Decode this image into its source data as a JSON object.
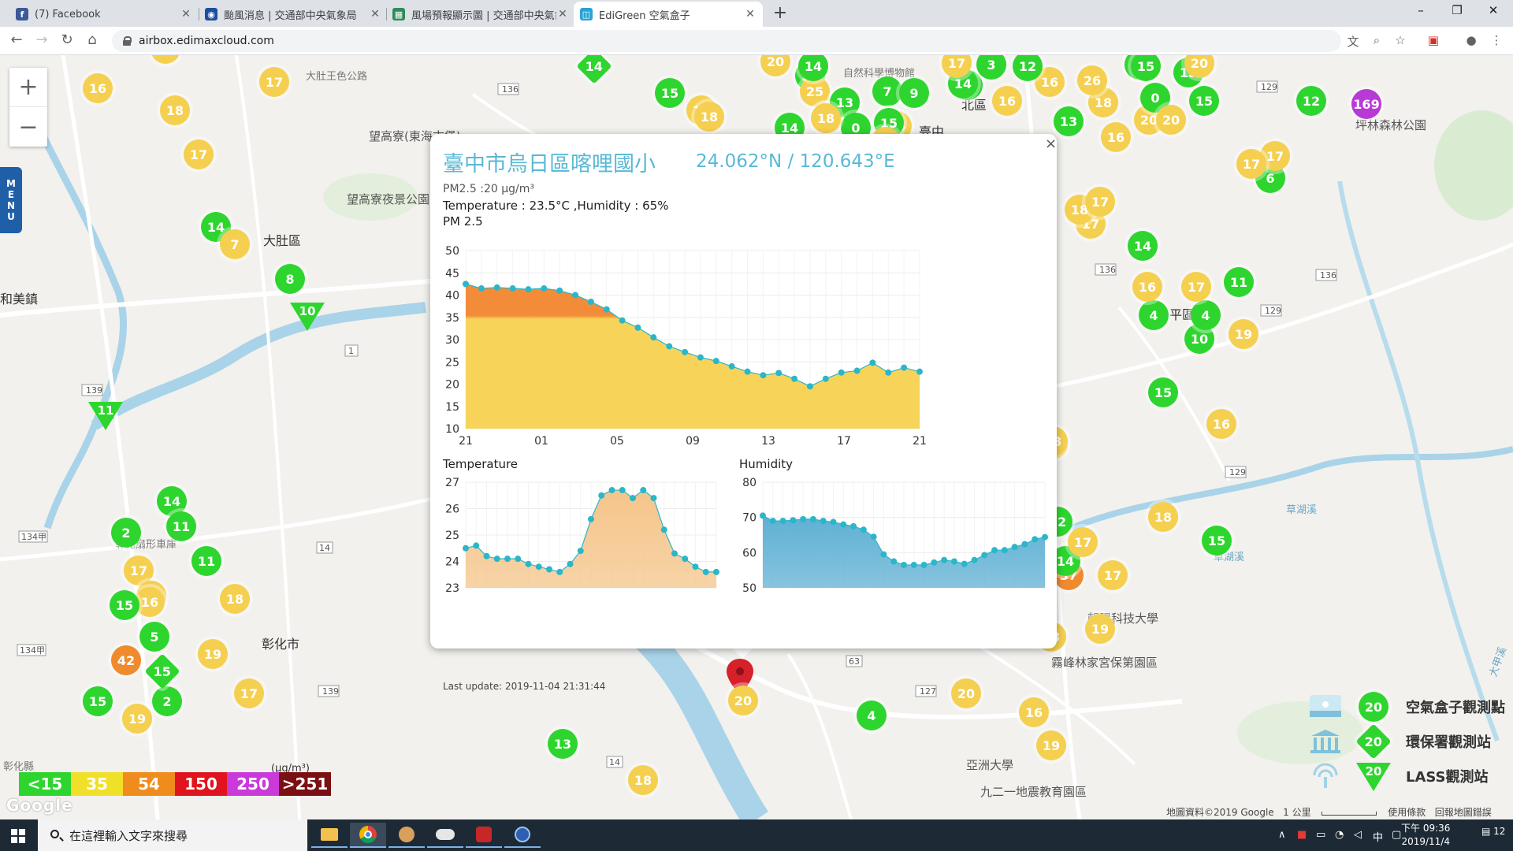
{
  "browser": {
    "tabs": [
      {
        "title": "(7) Facebook",
        "icon": "facebook-icon",
        "color": "#3b5998",
        "glyph": "f"
      },
      {
        "title": "颱風消息 | 交通部中央氣象局",
        "icon": "cwb-icon",
        "color": "#1a4fa0",
        "glyph": "◉"
      },
      {
        "title": "風場預報顯示圖 | 交通部中央氣象局",
        "icon": "cwb-wind-icon",
        "color": "#2e8b57",
        "glyph": "▦"
      },
      {
        "title": "EdiGreen 空氣盒子",
        "icon": "edigreen-icon",
        "color": "#29a3d4",
        "glyph": "◫"
      }
    ],
    "active_tab": 3,
    "url": "airbox.edimaxcloud.com",
    "new_tab": "+",
    "window_controls": {
      "minimize": "–",
      "maximize": "❐",
      "close": "✕"
    }
  },
  "map": {
    "zoom_in": "+",
    "zoom_out": "−",
    "menu": [
      "M",
      "E",
      "N",
      "U"
    ],
    "places": [
      {
        "text": "大肚區",
        "cls": "big"
      },
      {
        "text": "彰化市",
        "cls": "big"
      },
      {
        "text": "和美鎮",
        "cls": "big"
      },
      {
        "text": "望高寮(東海古堡)",
        "cls": ""
      },
      {
        "text": "望高寮夜景公園",
        "cls": ""
      },
      {
        "text": "大肚王色公路",
        "cls": "small"
      },
      {
        "text": "彰化縣",
        "cls": "small"
      },
      {
        "text": "彰化扇形車庫",
        "cls": "small"
      },
      {
        "text": "霧峰林家宮保第園區",
        "cls": ""
      },
      {
        "text": "亞洲大學",
        "cls": ""
      },
      {
        "text": "九二一地震教育園區",
        "cls": ""
      },
      {
        "text": "朝陽科技大學",
        "cls": ""
      },
      {
        "text": "坪林森林公園",
        "cls": ""
      },
      {
        "text": "北區",
        "cls": "big"
      },
      {
        "text": "平區",
        "cls": "big"
      },
      {
        "text": "自然科學博物館",
        "cls": "small"
      },
      {
        "text": "草湖溪",
        "cls": "river"
      },
      {
        "text": "草湖溪",
        "cls": "river"
      },
      {
        "text": "大甲溪",
        "cls": "river"
      },
      {
        "text": "臺中",
        "cls": "big"
      }
    ],
    "road_badges": [
      "136",
      "136",
      "136",
      "129",
      "129",
      "129",
      "139",
      "134甲",
      "134甲",
      "14",
      "14",
      "127",
      "139",
      "1",
      "63"
    ],
    "markers": [
      {
        "v": "18",
        "c": "y"
      },
      {
        "v": "16",
        "c": "y"
      },
      {
        "v": "17",
        "c": "y"
      },
      {
        "v": "18",
        "c": "y"
      },
      {
        "v": "17",
        "c": "y"
      },
      {
        "v": "14",
        "c": "g"
      },
      {
        "v": "7",
        "c": "y"
      },
      {
        "v": "8",
        "c": "g"
      },
      {
        "v": "14",
        "c": "g"
      },
      {
        "v": "2",
        "c": "g"
      },
      {
        "v": "11",
        "c": "g"
      },
      {
        "v": "11",
        "c": "g"
      },
      {
        "v": "17",
        "c": "y"
      },
      {
        "v": "16",
        "c": "y"
      },
      {
        "v": "16",
        "c": "y"
      },
      {
        "v": "18",
        "c": "y"
      },
      {
        "v": "15",
        "c": "g"
      },
      {
        "v": "5",
        "c": "g"
      },
      {
        "v": "19",
        "c": "y"
      },
      {
        "v": "42",
        "c": "o"
      },
      {
        "v": "2",
        "c": "g"
      },
      {
        "v": "15",
        "c": "g"
      },
      {
        "v": "19",
        "c": "y"
      },
      {
        "v": "17",
        "c": "y"
      },
      {
        "v": "13",
        "c": "g"
      },
      {
        "v": "18",
        "c": "y"
      },
      {
        "v": "4",
        "c": "g"
      },
      {
        "v": "20",
        "c": "y"
      },
      {
        "v": "16",
        "c": "y"
      },
      {
        "v": "19",
        "c": "y"
      },
      {
        "v": "18",
        "c": "y"
      },
      {
        "v": "19",
        "c": "y"
      },
      {
        "v": "37",
        "c": "o"
      },
      {
        "v": "17",
        "c": "y"
      },
      {
        "v": "12",
        "c": "g"
      },
      {
        "v": "14",
        "c": "g"
      },
      {
        "v": "18",
        "c": "y"
      },
      {
        "v": "15",
        "c": "g"
      },
      {
        "v": "17",
        "c": "y"
      },
      {
        "v": "19",
        "c": "y"
      },
      {
        "v": "18",
        "c": "y"
      },
      {
        "v": "16",
        "c": "y"
      },
      {
        "v": "15",
        "c": "g"
      },
      {
        "v": "19",
        "c": "y"
      },
      {
        "v": "10",
        "c": "g"
      },
      {
        "v": "4",
        "c": "g"
      },
      {
        "v": "4",
        "c": "g"
      },
      {
        "v": "16",
        "c": "y"
      },
      {
        "v": "17",
        "c": "y"
      },
      {
        "v": "11",
        "c": "g"
      },
      {
        "v": "14",
        "c": "g"
      },
      {
        "v": "17",
        "c": "y"
      },
      {
        "v": "18",
        "c": "y"
      },
      {
        "v": "17",
        "c": "y"
      },
      {
        "v": "6",
        "c": "g"
      },
      {
        "v": "17",
        "c": "y"
      },
      {
        "v": "17",
        "c": "y"
      },
      {
        "v": "12",
        "c": "g"
      },
      {
        "v": "169",
        "c": "p"
      },
      {
        "v": "15",
        "c": "g"
      },
      {
        "v": "20",
        "c": "y"
      },
      {
        "v": "16",
        "c": "y"
      },
      {
        "v": "13",
        "c": "g"
      },
      {
        "v": "18",
        "c": "y"
      },
      {
        "v": "26",
        "c": "y"
      },
      {
        "v": "16",
        "c": "y"
      },
      {
        "v": "8",
        "c": "g"
      },
      {
        "v": "15",
        "c": "g"
      },
      {
        "v": "12",
        "c": "g"
      },
      {
        "v": "3",
        "c": "g"
      },
      {
        "v": "11",
        "c": "g"
      },
      {
        "v": "15",
        "c": "g"
      },
      {
        "v": "0",
        "c": "g"
      },
      {
        "v": "20",
        "c": "y"
      },
      {
        "v": "14",
        "c": "g"
      },
      {
        "v": "15",
        "c": "g"
      },
      {
        "v": "25",
        "c": "y"
      },
      {
        "v": "7",
        "c": "g"
      },
      {
        "v": "9",
        "c": "g"
      },
      {
        "v": "18",
        "c": "y"
      },
      {
        "v": "16",
        "c": "y"
      },
      {
        "v": "15",
        "c": "g"
      },
      {
        "v": "13",
        "c": "g"
      },
      {
        "v": "18",
        "c": "y"
      },
      {
        "v": "15",
        "c": "g"
      },
      {
        "v": "14",
        "c": "g"
      },
      {
        "v": "0",
        "c": "g"
      },
      {
        "v": "20",
        "c": "y"
      },
      {
        "v": "17",
        "c": "y"
      },
      {
        "v": "20",
        "c": "y"
      },
      {
        "v": "14",
        "c": "g"
      },
      {
        "v": "15",
        "c": "g"
      },
      {
        "v": "17",
        "c": "y"
      },
      {
        "v": "18",
        "c": "y"
      },
      {
        "v": "18",
        "c": "y"
      },
      {
        "v": "16",
        "c": "y"
      }
    ],
    "diamond_markers": [
      {
        "v": "14"
      },
      {
        "v": "15"
      }
    ],
    "triangle_markers": [
      {
        "v": "10"
      },
      {
        "v": "11"
      }
    ],
    "selected_pin_value": "20",
    "aq_legend": [
      {
        "label": "<15",
        "color": "#2ed52e"
      },
      {
        "label": "35",
        "color": "#f0e02a"
      },
      {
        "label": "54",
        "color": "#f08c1e"
      },
      {
        "label": "150",
        "color": "#e0141e"
      },
      {
        "label": "250",
        "color": "#c93ad8"
      },
      {
        "label": ">251",
        "color": "#7a0f14"
      }
    ],
    "aq_unit": "(μg/m³)",
    "google_logo": "Google",
    "footer": {
      "attribution": "地圖資料©2019 Google",
      "scale": "1 公里",
      "terms": "使用條款",
      "report": "回報地圖錯誤"
    },
    "station_legend": [
      {
        "label": "空氣盒子觀測點",
        "value": "20",
        "shape": "circle",
        "icon": "airbox-icon"
      },
      {
        "label": "環保署觀測站",
        "value": "20",
        "shape": "diamond",
        "icon": "epa-building-icon"
      },
      {
        "label": "LASS觀測站",
        "value": "20",
        "shape": "triangle",
        "icon": "lass-antenna-icon"
      }
    ]
  },
  "popup": {
    "close": "×",
    "site_name": "臺中市烏日區喀哩國小",
    "coords": "24.062°N / 120.643°E",
    "pm_line": "PM2.5 :20 μg/m³",
    "temp_humidity": "Temperature : 23.5°C ,Humidity : 65%",
    "pm_chart_title": "PM 2.5",
    "temp_chart_title": "Temperature",
    "hum_chart_title": "Humidity",
    "last_update": "Last update: 2019-11-04 21:31:44"
  },
  "chart_data": [
    {
      "type": "area",
      "title": "PM 2.5",
      "x_ticks": [
        "21",
        "01",
        "05",
        "09",
        "13",
        "17",
        "21"
      ],
      "y_ticks": [
        10,
        15,
        20,
        25,
        30,
        35,
        40,
        45,
        50
      ],
      "ylim": [
        10,
        50
      ],
      "threshold": 35,
      "colors": {
        "low": "#f7d35a",
        "high": "#f28c38",
        "point": "#2bb6c9"
      },
      "series": [
        {
          "values": [
            42.5,
            41.5,
            41.7,
            41.5,
            41.3,
            41.5,
            41.0,
            40.0,
            38.5,
            36.8,
            34.3,
            32.7,
            30.5,
            28.5,
            27.2,
            26.0,
            25.2,
            24.0,
            22.8,
            22.0,
            22.5,
            21.2,
            19.5,
            21.2,
            22.6,
            23.0,
            24.8,
            22.6,
            23.7,
            22.8
          ]
        }
      ]
    },
    {
      "type": "area",
      "title": "Temperature",
      "y_ticks": [
        23,
        24,
        25,
        26,
        27
      ],
      "ylim": [
        23,
        27
      ],
      "colors": {
        "fill": "#f5c58a",
        "point": "#2bb6c9"
      },
      "series": [
        {
          "values": [
            24.5,
            24.6,
            24.2,
            24.1,
            24.1,
            24.1,
            23.9,
            23.8,
            23.7,
            23.6,
            23.9,
            24.4,
            25.6,
            26.5,
            26.7,
            26.7,
            26.4,
            26.7,
            26.4,
            25.2,
            24.3,
            24.1,
            23.8,
            23.6,
            23.6
          ]
        }
      ]
    },
    {
      "type": "area",
      "title": "Humidity",
      "y_ticks": [
        50,
        60,
        70,
        80
      ],
      "ylim": [
        50,
        80
      ],
      "colors": {
        "fill": "#5fb0d4",
        "point": "#2bb6c9"
      },
      "series": [
        {
          "values": [
            70.5,
            69,
            69,
            69.2,
            69.5,
            69.5,
            69,
            68.7,
            68,
            67.5,
            66.5,
            64.5,
            59.5,
            57.5,
            56.5,
            56.5,
            56.5,
            57.2,
            57.9,
            57.5,
            56.8,
            57.9,
            59.3,
            60.7,
            60.7,
            61.6,
            62.4,
            63.8,
            64.4
          ]
        }
      ]
    }
  ],
  "taskbar": {
    "search_placeholder": "在這裡輸入文字來搜尋",
    "time": "下午 09:36",
    "date": "2019/11/4",
    "ime": "中",
    "notifications": "12"
  }
}
